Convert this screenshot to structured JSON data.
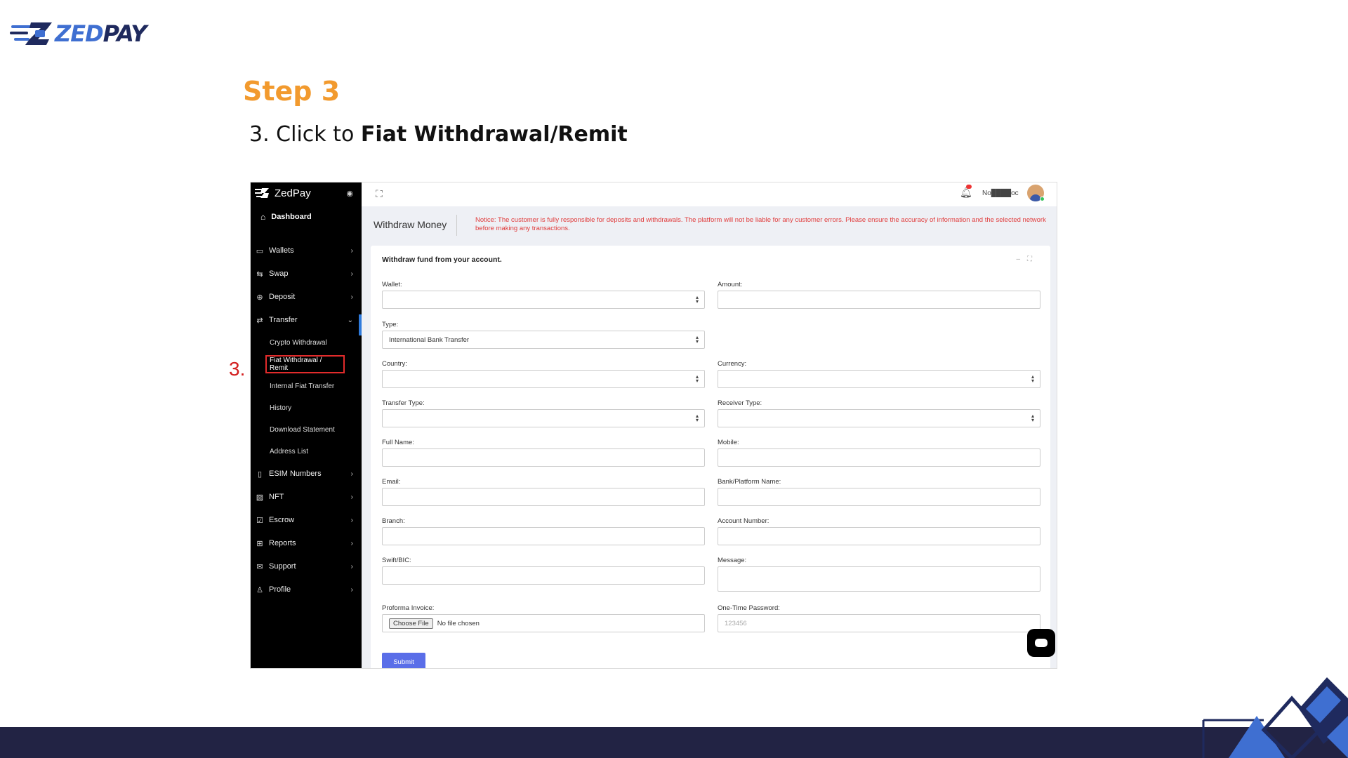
{
  "logo": {
    "zed": "ZED",
    "pay": "PAY"
  },
  "step": {
    "title": "Step 3",
    "prefix": "3. Click to ",
    "bold": "Fiat Withdrawal/Remit"
  },
  "marker": "3.",
  "app": {
    "brand": "ZedPay",
    "sidebar": {
      "dashboard": "Dashboard",
      "items": [
        {
          "label": "Wallets",
          "icon": "wallet-icon"
        },
        {
          "label": "Swap",
          "icon": "swap-icon"
        },
        {
          "label": "Deposit",
          "icon": "deposit-icon"
        },
        {
          "label": "Transfer",
          "icon": "transfer-icon"
        },
        {
          "label": "ESIM Numbers",
          "icon": "phone-icon"
        },
        {
          "label": "NFT",
          "icon": "image-icon"
        },
        {
          "label": "Escrow",
          "icon": "check-square-icon"
        },
        {
          "label": "Reports",
          "icon": "grid-icon"
        },
        {
          "label": "Support",
          "icon": "mail-icon"
        },
        {
          "label": "Profile",
          "icon": "user-icon"
        }
      ],
      "transfer_sub": [
        "Crypto Withdrawal",
        "Fiat Withdrawal / Remit",
        "Internal Fiat Transfer",
        "History",
        "Download Statement",
        "Address List"
      ]
    },
    "topbar": {
      "user_name": "No████oc"
    },
    "page_title": "Withdraw Money",
    "notice": "Notice: The customer is fully responsible for deposits and withdrawals. The platform will not be liable for any customer errors. Please ensure the accuracy of information and the selected network before making any transactions.",
    "card_title": "Withdraw fund from your account.",
    "form": {
      "wallet": {
        "label": "Wallet:",
        "value": ""
      },
      "amount": {
        "label": "Amount:",
        "value": ""
      },
      "type": {
        "label": "Type:",
        "value": "International Bank Transfer"
      },
      "country": {
        "label": "Country:",
        "value": ""
      },
      "currency": {
        "label": "Currency:",
        "value": ""
      },
      "transfer_type": {
        "label": "Transfer Type:",
        "value": ""
      },
      "receiver_type": {
        "label": "Receiver Type:",
        "value": ""
      },
      "full_name": {
        "label": "Full Name:",
        "value": ""
      },
      "mobile": {
        "label": "Mobile:",
        "value": ""
      },
      "email": {
        "label": "Email:",
        "value": ""
      },
      "bank_name": {
        "label": "Bank/Platform Name:",
        "value": ""
      },
      "branch": {
        "label": "Branch:",
        "value": ""
      },
      "account_number": {
        "label": "Account Number:",
        "value": ""
      },
      "swift": {
        "label": "Swift/BIC:",
        "value": ""
      },
      "message": {
        "label": "Message:",
        "value": ""
      },
      "invoice": {
        "label": "Proforma Invoice:",
        "button": "Choose File",
        "status": "No file chosen"
      },
      "otp": {
        "label": "One-Time Password:",
        "placeholder": "123456"
      },
      "submit": "Submit"
    }
  },
  "colors": {
    "accent_orange": "#f29a2e",
    "highlight_red": "#e12b2b",
    "submit_blue": "#5a6ee8",
    "footer": "#222344"
  }
}
